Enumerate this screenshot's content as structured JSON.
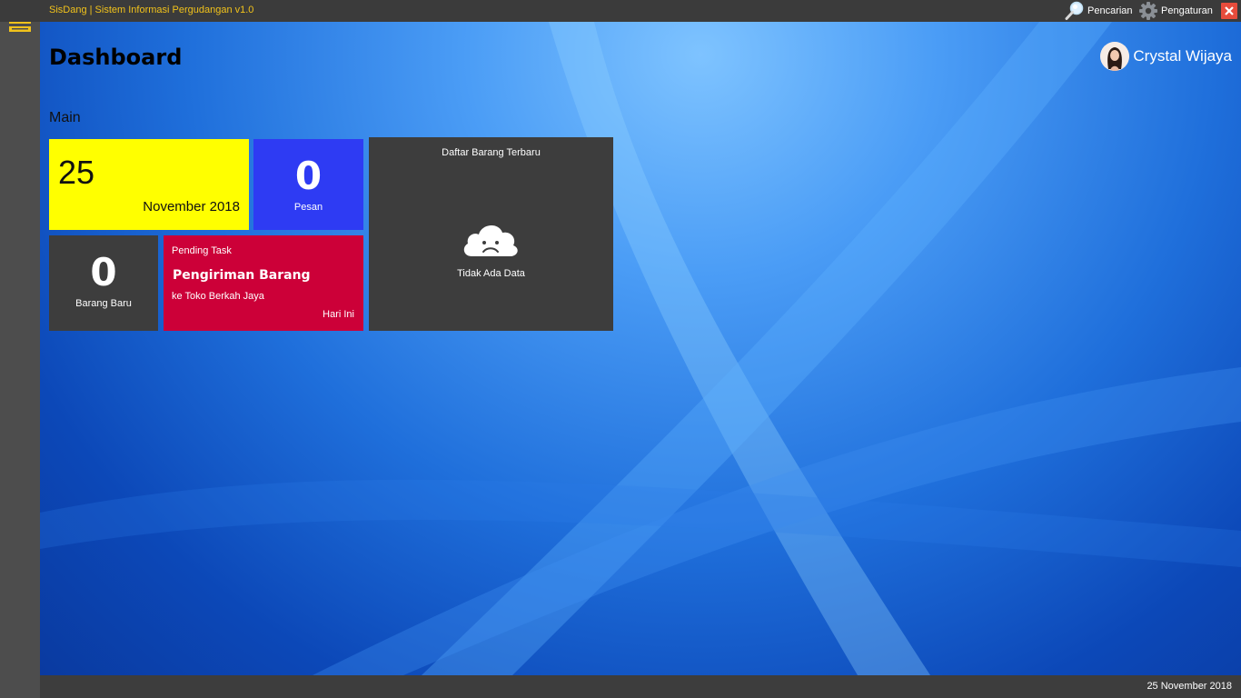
{
  "window": {
    "title": "SisDang | Sistem Informasi Pergudangan v1.0",
    "search_label": "Pencarian",
    "settings_label": "Pengaturan",
    "accent_color": "#f1c21b",
    "close_color": "#e74c3c"
  },
  "header": {
    "page_title": "Dashboard",
    "user_name": "Crystal Wijaya"
  },
  "main": {
    "section_label": "Main",
    "date_tile": {
      "day": "25",
      "month_year": "November 2018",
      "color": "#ffff00"
    },
    "pesan_tile": {
      "count": "0",
      "label": "Pesan",
      "color": "#2e3bf3"
    },
    "barang_baru_tile": {
      "count": "0",
      "label": "Barang Baru",
      "color": "#3d3d3d"
    },
    "pending_task_tile": {
      "header": "Pending Task",
      "title": "Pengiriman Barang",
      "subtitle": "ke Toko Berkah Jaya",
      "when": "Hari Ini",
      "color": "#cc0038"
    },
    "latest_items_tile": {
      "title": "Daftar Barang Terbaru",
      "empty_icon": "sad-cloud-icon",
      "empty_text": "Tidak Ada Data"
    }
  },
  "statusbar": {
    "date": "25 November 2018"
  }
}
